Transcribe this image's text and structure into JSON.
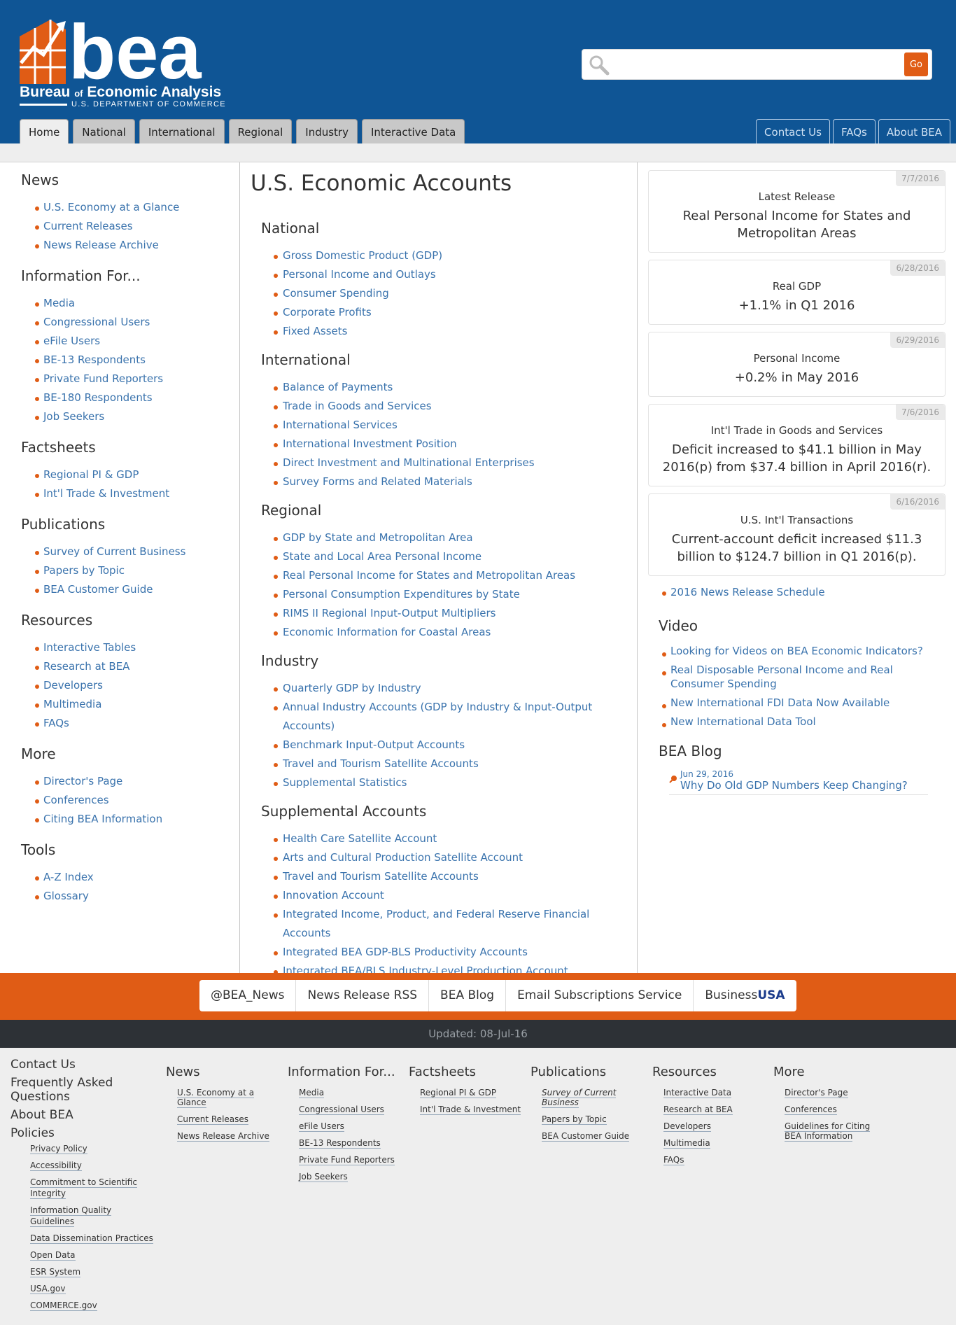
{
  "header": {
    "logo_text": "bea",
    "org_name_part1": "Bureau",
    "org_name_of": "of",
    "org_name_part2": "Economic Analysis",
    "dept": "U.S. DEPARTMENT OF COMMERCE",
    "search": {
      "placeholder": "",
      "go_label": "Go"
    },
    "tabs": [
      "Home",
      "National",
      "International",
      "Regional",
      "Industry",
      "Interactive Data"
    ],
    "right_tabs": [
      "Contact Us",
      "FAQs",
      "About BEA"
    ]
  },
  "left_nav": [
    {
      "title": "News",
      "items": [
        "U.S. Economy at a Glance",
        "Current Releases",
        "News Release Archive"
      ]
    },
    {
      "title": "Information For...",
      "items": [
        "Media",
        "Congressional Users",
        "eFile Users",
        "BE-13 Respondents",
        "Private Fund Reporters",
        "BE-180 Respondents",
        "Job Seekers"
      ]
    },
    {
      "title": "Factsheets",
      "items": [
        "Regional PI & GDP",
        "Int'l Trade & Investment"
      ]
    },
    {
      "title": "Publications",
      "items": [
        "Survey of Current Business",
        "Papers by Topic",
        "BEA Customer Guide"
      ]
    },
    {
      "title": "Resources",
      "items": [
        "Interactive Tables",
        "Research at BEA",
        "Developers",
        "Multimedia",
        "FAQs"
      ]
    },
    {
      "title": "More",
      "items": [
        "Director's Page",
        "Conferences",
        "Citing BEA Information"
      ]
    },
    {
      "title": "Tools",
      "items": [
        "A-Z Index",
        "Glossary"
      ]
    }
  ],
  "main": {
    "title": "U.S. Economic Accounts",
    "sections": [
      {
        "title": "National",
        "items": [
          "Gross Domestic Product (GDP)",
          "Personal Income and Outlays",
          "Consumer Spending",
          "Corporate Profits",
          "Fixed Assets"
        ]
      },
      {
        "title": "International",
        "items": [
          "Balance of Payments",
          "Trade in Goods and Services",
          "International Services",
          "International Investment Position",
          "Direct Investment and Multinational Enterprises",
          "Survey Forms and Related Materials"
        ]
      },
      {
        "title": "Regional",
        "items": [
          "GDP by State and Metropolitan Area",
          "State and Local Area Personal Income",
          "Real Personal Income for States and Metropolitan Areas",
          "Personal Consumption Expenditures by State",
          "RIMS II Regional Input-Output Multipliers",
          "Economic Information for Coastal Areas"
        ]
      },
      {
        "title": "Industry",
        "items": [
          "Quarterly GDP by Industry",
          "Annual Industry Accounts (GDP by Industry & Input-Output Accounts)",
          "Benchmark Input-Output Accounts",
          "Travel and Tourism Satellite Accounts",
          "Supplemental Statistics"
        ]
      },
      {
        "title": "Supplemental Accounts",
        "items": [
          "Health Care Satellite Account",
          "Arts and Cultural Production Satellite Account",
          "Travel and Tourism Satellite Accounts",
          "Innovation Account",
          "Integrated Income, Product, and Federal Reserve Financial Accounts",
          "Integrated BEA GDP-BLS Productivity Accounts",
          "Integrated BEA/BLS Industry-Level Production Account"
        ]
      }
    ]
  },
  "right": {
    "cards": [
      {
        "date": "7/7/2016",
        "label": "Latest Release",
        "value": "Real Personal Income for States and Metropolitan Areas"
      },
      {
        "date": "6/28/2016",
        "label": "Real GDP",
        "value": "+1.1% in Q1 2016"
      },
      {
        "date": "6/29/2016",
        "label": "Personal Income",
        "value": "+0.2% in May 2016"
      },
      {
        "date": "7/6/2016",
        "label": "Int'l Trade in Goods and Services",
        "value": "Deficit increased to $41.1 billion in May 2016(p) from $37.4 billion in April 2016(r)."
      },
      {
        "date": "6/16/2016",
        "label": "U.S. Int'l Transactions",
        "value": "Current-account deficit increased $11.3 billion to $124.7 billion in Q1 2016(p)."
      }
    ],
    "schedule_link": "2016 News Release Schedule",
    "video_title": "Video",
    "videos": [
      "Looking for Videos on BEA Economic Indicators?",
      "Real Disposable Personal Income and Real Consumer Spending",
      "New International FDI Data Now Available",
      "New International Data Tool"
    ],
    "blog_title": "BEA Blog",
    "blog": {
      "date": "Jun 29, 2016",
      "title": "Why Do Old GDP Numbers Keep Changing?"
    }
  },
  "social": {
    "items": [
      "@BEA_News",
      "News Release RSS",
      "BEA Blog",
      "Email Subscriptions Service"
    ],
    "busa_part1": "Business",
    "busa_part2": "USA"
  },
  "updated": "Updated: 08-Jul-16",
  "footer": {
    "left_links": [
      "Contact Us",
      "Frequently Asked Questions",
      "About BEA",
      "Policies"
    ],
    "policies": [
      "Privacy Policy",
      "Accessibility",
      "Commitment to Scientific Integrity",
      "Information Quality Guidelines",
      "Data Dissemination Practices",
      "Open Data",
      "ESR System",
      "USA.gov",
      "COMMERCE.gov"
    ],
    "columns": [
      {
        "title": "News",
        "items": [
          "U.S. Economy at a Glance",
          "Current Releases",
          "News Release Archive"
        ]
      },
      {
        "title": "Information For...",
        "items": [
          "Media",
          "Congressional Users",
          "eFile Users",
          "BE-13 Respondents",
          "Private Fund Reporters",
          "Job Seekers"
        ]
      },
      {
        "title": "Factsheets",
        "items": [
          "Regional PI & GDP",
          "Int'l Trade & Investment"
        ]
      },
      {
        "title": "Publications",
        "items": [
          "Survey of Current Business",
          "Papers by Topic",
          "BEA Customer Guide"
        ]
      },
      {
        "title": "Resources",
        "items": [
          "Interactive Data",
          "Research at BEA",
          "Developers",
          "Multimedia",
          "FAQs"
        ]
      },
      {
        "title": "More",
        "items": [
          "Director's Page",
          "Conferences",
          "Guidelines for Citing BEA Information"
        ]
      }
    ]
  },
  "colors": {
    "header_blue": "#0f5595",
    "accent_orange": "#e05c15",
    "link_blue": "#3a73ad",
    "footer_dark": "#2d3136"
  }
}
